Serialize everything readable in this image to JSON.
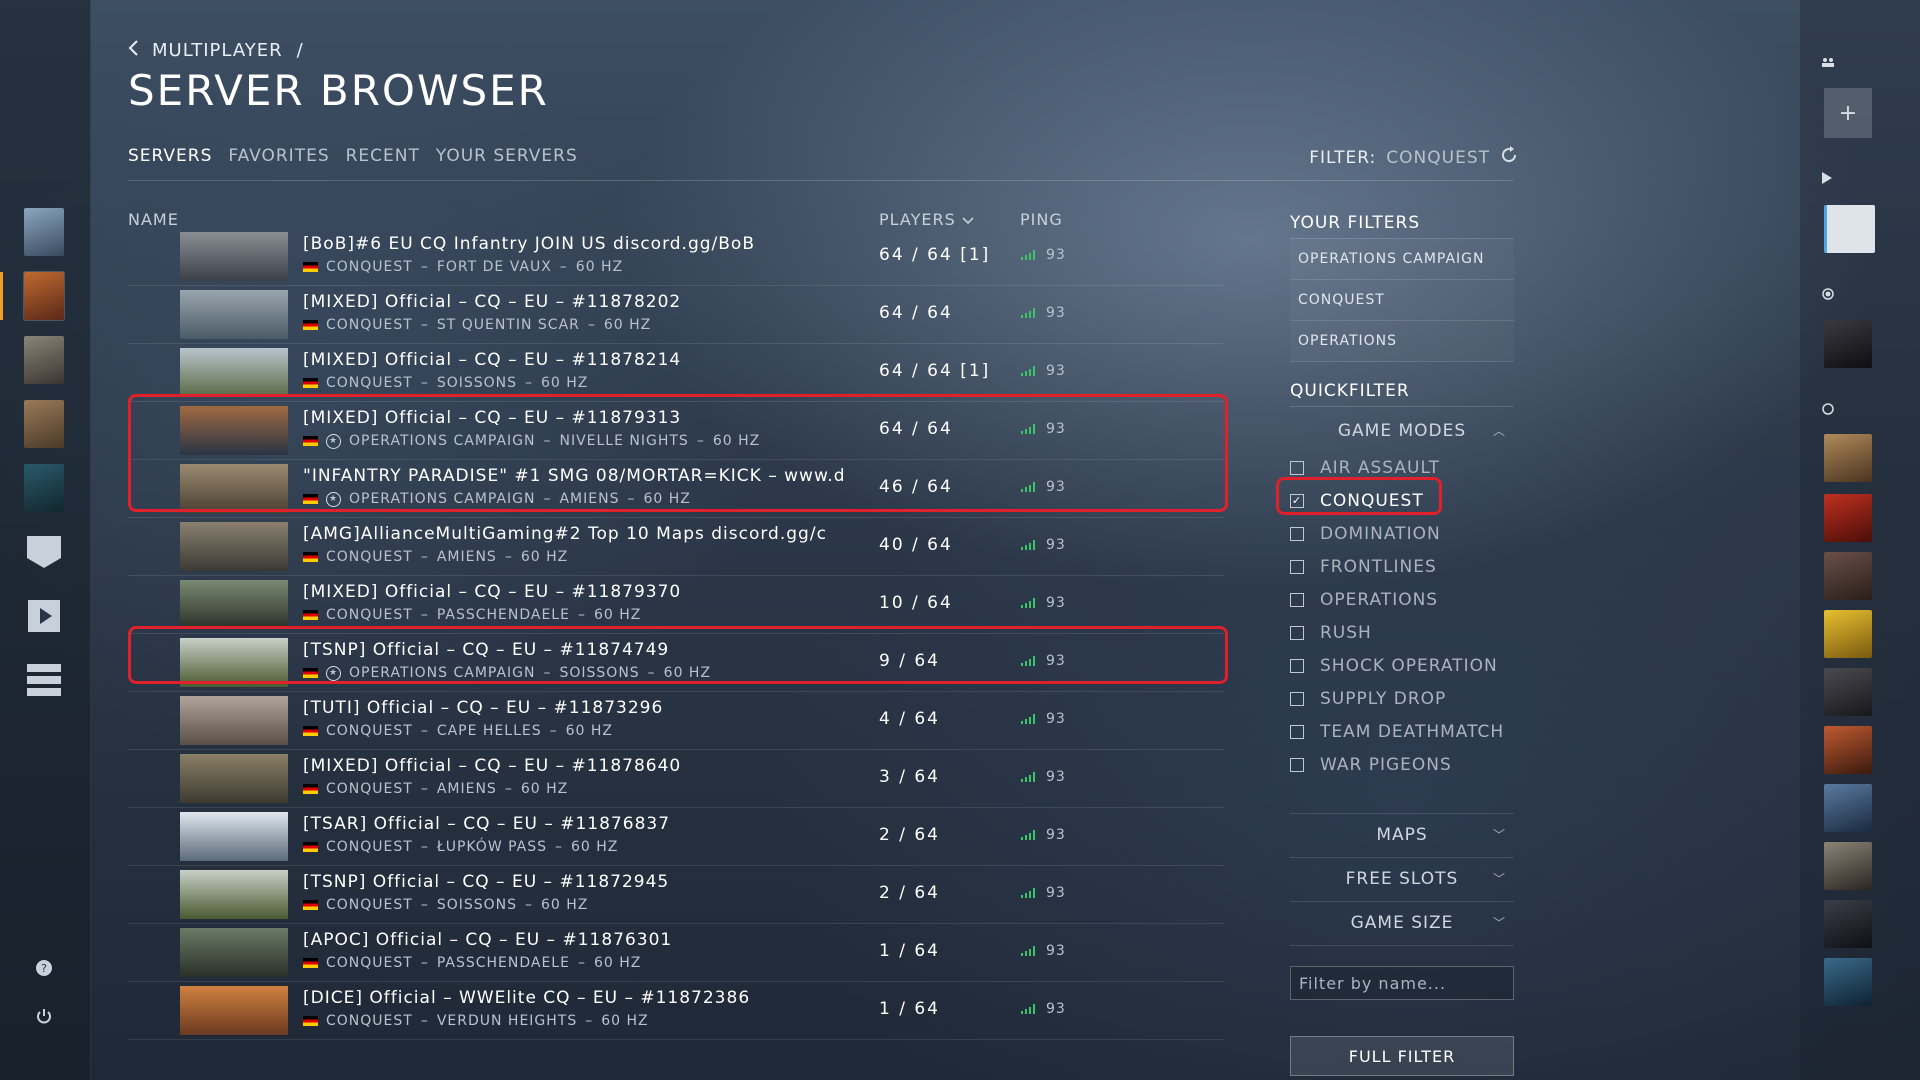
{
  "breadcrumb": {
    "parent": "MULTIPLAYER",
    "separator": "/"
  },
  "page_title": "SERVER BROWSER",
  "tabs": [
    "SERVERS",
    "FAVORITES",
    "RECENT",
    "YOUR SERVERS"
  ],
  "active_tab": "SERVERS",
  "filter_status": {
    "label": "FILTER:",
    "value": "CONQUEST"
  },
  "columns": {
    "name": "NAME",
    "players": "PLAYERS",
    "ping": "PING"
  },
  "servers": [
    {
      "name": "[BoB]#6 EU CQ Infantry JOIN US discord.gg/BoB",
      "mode": "CONQUEST",
      "map": "FORT DE VAUX",
      "rate": "60 HZ",
      "operation": false,
      "players": "64 / 64 [1]",
      "ping": "93"
    },
    {
      "name": "[MIXED] Official – CQ – EU – #11878202",
      "mode": "CONQUEST",
      "map": "ST QUENTIN SCAR",
      "rate": "60 HZ",
      "operation": false,
      "players": "64 / 64",
      "ping": "93"
    },
    {
      "name": "[MIXED] Official – CQ – EU – #11878214",
      "mode": "CONQUEST",
      "map": "SOISSONS",
      "rate": "60 HZ",
      "operation": false,
      "players": "64 / 64 [1]",
      "ping": "93"
    },
    {
      "name": "[MIXED] Official – CQ – EU – #11879313",
      "mode": "OPERATIONS CAMPAIGN",
      "map": "NIVELLE NIGHTS",
      "rate": "60 HZ",
      "operation": true,
      "players": "64 / 64",
      "ping": "93"
    },
    {
      "name": "\"INFANTRY PARADISE\" #1 SMG 08/MORTAR=KICK – www.d",
      "mode": "OPERATIONS CAMPAIGN",
      "map": "AMIENS",
      "rate": "60 HZ",
      "operation": true,
      "players": "46 / 64",
      "ping": "93"
    },
    {
      "name": "[AMG]AllianceMultiGaming#2 Top 10 Maps discord.gg/c",
      "mode": "CONQUEST",
      "map": "AMIENS",
      "rate": "60 HZ",
      "operation": false,
      "players": "40 / 64",
      "ping": "93"
    },
    {
      "name": "[MIXED] Official – CQ – EU – #11879370",
      "mode": "CONQUEST",
      "map": "PASSCHENDAELE",
      "rate": "60 HZ",
      "operation": false,
      "players": "10 / 64",
      "ping": "93"
    },
    {
      "name": "[TSNP] Official – CQ – EU – #11874749",
      "mode": "OPERATIONS CAMPAIGN",
      "map": "SOISSONS",
      "rate": "60 HZ",
      "operation": true,
      "players": "9 / 64",
      "ping": "93"
    },
    {
      "name": "[TUTI] Official – CQ – EU – #11873296",
      "mode": "CONQUEST",
      "map": "CAPE HELLES",
      "rate": "60 HZ",
      "operation": false,
      "players": "4 / 64",
      "ping": "93"
    },
    {
      "name": "[MIXED] Official – CQ – EU – #11878640",
      "mode": "CONQUEST",
      "map": "AMIENS",
      "rate": "60 HZ",
      "operation": false,
      "players": "3 / 64",
      "ping": "93"
    },
    {
      "name": "[TSAR] Official – CQ – EU – #11876837",
      "mode": "CONQUEST",
      "map": "ŁUPKÓW PASS",
      "rate": "60 HZ",
      "operation": false,
      "players": "2 / 64",
      "ping": "93"
    },
    {
      "name": "[TSNP] Official – CQ – EU – #11872945",
      "mode": "CONQUEST",
      "map": "SOISSONS",
      "rate": "60 HZ",
      "operation": false,
      "players": "2 / 64",
      "ping": "93"
    },
    {
      "name": "[APOC] Official – CQ – EU – #11876301",
      "mode": "CONQUEST",
      "map": "PASSCHENDAELE",
      "rate": "60 HZ",
      "operation": false,
      "players": "1 / 64",
      "ping": "93"
    },
    {
      "name": "[DICE] Official – WWElite CQ – EU – #11872386",
      "mode": "CONQUEST",
      "map": "VERDUN HEIGHTS",
      "rate": "60 HZ",
      "operation": false,
      "players": "1 / 64",
      "ping": "93"
    }
  ],
  "your_filters": {
    "heading": "YOUR FILTERS",
    "items": [
      "OPERATIONS CAMPAIGN",
      "CONQUEST",
      "OPERATIONS"
    ]
  },
  "quickfilter": {
    "heading": "QUICKFILTER",
    "game_modes_label": "GAME MODES",
    "modes": [
      {
        "label": "AIR ASSAULT",
        "checked": false
      },
      {
        "label": "CONQUEST",
        "checked": true
      },
      {
        "label": "DOMINATION",
        "checked": false
      },
      {
        "label": "FRONTLINES",
        "checked": false
      },
      {
        "label": "OPERATIONS",
        "checked": false
      },
      {
        "label": "RUSH",
        "checked": false
      },
      {
        "label": "SHOCK OPERATION",
        "checked": false
      },
      {
        "label": "SUPPLY DROP",
        "checked": false
      },
      {
        "label": "TEAM DEATHMATCH",
        "checked": false
      },
      {
        "label": "WAR PIGEONS",
        "checked": false
      }
    ],
    "maps_label": "MAPS",
    "free_slots_label": "FREE SLOTS",
    "game_size_label": "GAME SIZE",
    "name_filter_placeholder": "Filter by name...",
    "full_filter_label": "FULL FILTER"
  },
  "colors": {
    "highlight": "#e0202a",
    "ping_good": "#3cc46a",
    "accent": "#f0a020"
  },
  "thumb_palette": [
    [
      "#3a4048",
      "#8a8f96"
    ],
    [
      "#4a5a66",
      "#9aa6ae"
    ],
    [
      "#5a6a44",
      "#b8c4cc"
    ],
    [
      "#2a3444",
      "#a06a40"
    ],
    [
      "#4a4032",
      "#9a8a70"
    ],
    [
      "#3a3a34",
      "#8a8070"
    ],
    [
      "#2a3028",
      "#7a8a72"
    ],
    [
      "#4a5a30",
      "#c8d0c8"
    ],
    [
      "#5a5048",
      "#b0a49a"
    ],
    [
      "#3e3a30",
      "#8a8068"
    ],
    [
      "#5a6a78",
      "#dfe6ee"
    ],
    [
      "#4a5a30",
      "#c8d0c8"
    ],
    [
      "#2a3028",
      "#6a7a66"
    ],
    [
      "#6a3a20",
      "#d08040"
    ]
  ]
}
